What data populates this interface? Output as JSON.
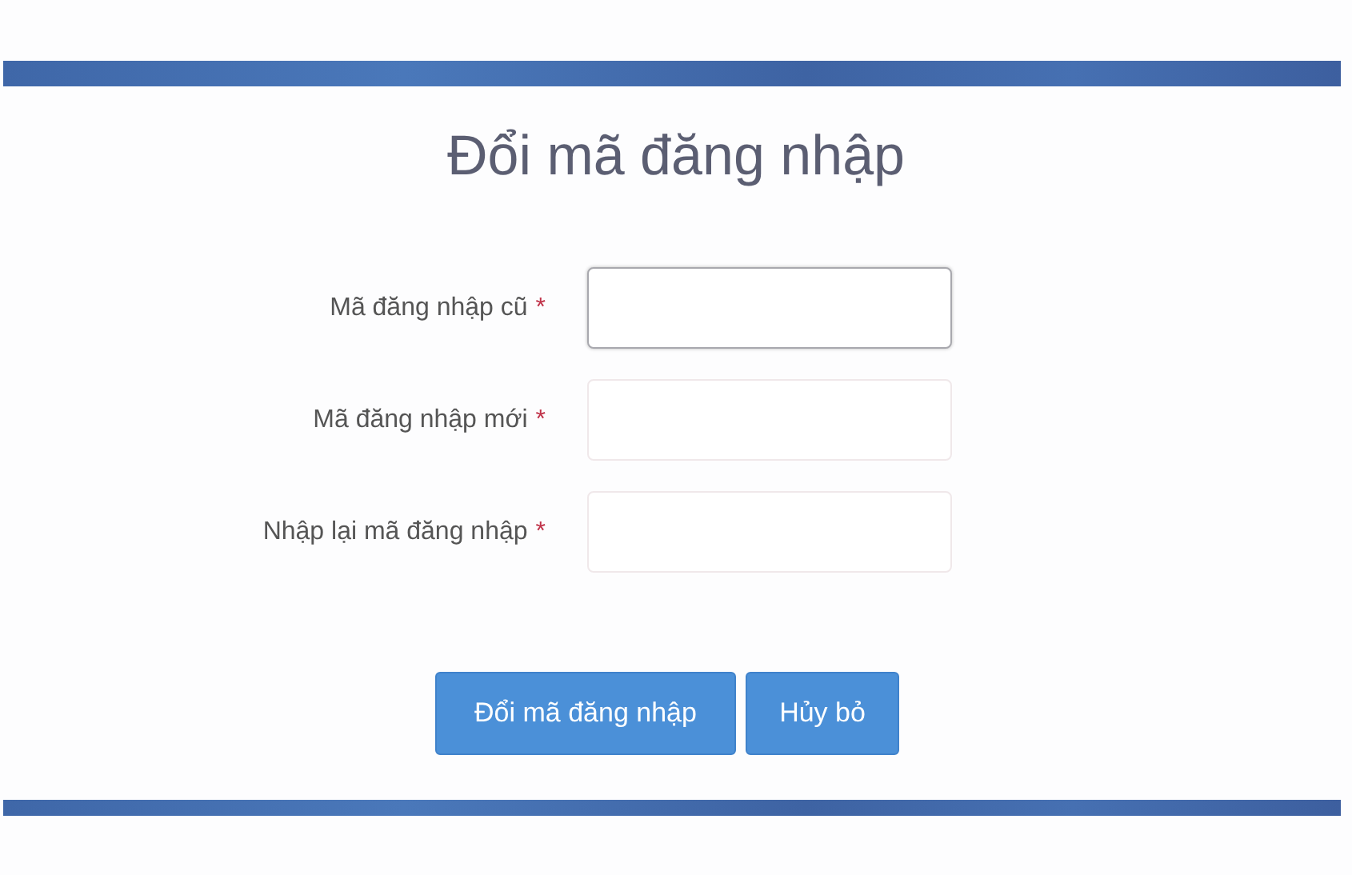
{
  "title": "Đổi mã đăng nhập",
  "fields": [
    {
      "label": "Mã đăng nhập cũ",
      "required_mark": "*",
      "focused": true
    },
    {
      "label": "Mã đăng nhập mới",
      "required_mark": "*",
      "focused": false
    },
    {
      "label": "Nhập lại mã đăng nhập",
      "required_mark": "*",
      "focused": false
    }
  ],
  "buttons": [
    {
      "label": "Đổi mã đăng nhập"
    },
    {
      "label": "Hủy bỏ"
    }
  ]
}
